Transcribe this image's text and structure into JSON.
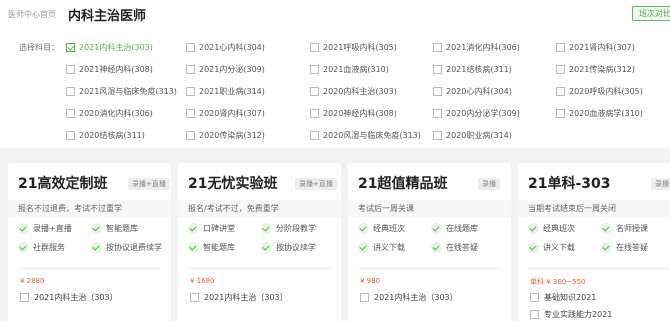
{
  "header": {
    "breadcrumb": "医师中心首页",
    "title": "内科主治医师",
    "compare_label": "班次对比"
  },
  "filter": {
    "label": "选择科目：",
    "options": [
      {
        "label": "2021内科主治(303)",
        "checked": true
      },
      {
        "label": "2021心内科(304)",
        "checked": false
      },
      {
        "label": "2021呼吸内科(305)",
        "checked": false
      },
      {
        "label": "2021消化内科(306)",
        "checked": false
      },
      {
        "label": "2021肾内科(307)",
        "checked": false
      },
      {
        "label": "2021神经内科(308)",
        "checked": false
      },
      {
        "label": "2021内分泌(309)",
        "checked": false
      },
      {
        "label": "2021血液病(310)",
        "checked": false
      },
      {
        "label": "2021结核病(311)",
        "checked": false
      },
      {
        "label": "2021传染病(312)",
        "checked": false
      },
      {
        "label": "2021风湿与临床免疫(313)",
        "checked": false
      },
      {
        "label": "2021职业病(314)",
        "checked": false
      },
      {
        "label": "2020内科主治(303)",
        "checked": false
      },
      {
        "label": "2020心内科(304)",
        "checked": false
      },
      {
        "label": "2020呼吸内科(305)",
        "checked": false
      },
      {
        "label": "2020消化内科(306)",
        "checked": false
      },
      {
        "label": "2020肾内科(307)",
        "checked": false
      },
      {
        "label": "2020神经内科(308)",
        "checked": false
      },
      {
        "label": "2020内分泌学(309)",
        "checked": false
      },
      {
        "label": "2020血液病学(310)",
        "checked": false
      },
      {
        "label": "2020结核病(311)",
        "checked": false
      },
      {
        "label": "2020传染病(312)",
        "checked": false
      },
      {
        "label": "2020风湿与临床免疫(313)",
        "checked": false
      },
      {
        "label": "2020职业病(314)",
        "checked": false
      }
    ]
  },
  "cards": [
    {
      "title": "21高效定制班",
      "tag": "录播+直播",
      "desc": "报名不过退费，考试不过重学",
      "features": [
        "录播+直播",
        "智能题库",
        "社群服务",
        "按协议退费续学"
      ],
      "price": "¥ 2880",
      "courses": [
        "2021内科主治（303）"
      ]
    },
    {
      "title": "21无忧实验班",
      "tag": "录播+直播",
      "desc": "报名/考试不过，免费重学",
      "features": [
        "口碑讲堂",
        "分阶段教学",
        "智能题库",
        "按协议续学"
      ],
      "price": "¥ 1680",
      "courses": [
        "2021内科主治（303）"
      ]
    },
    {
      "title": "21超值精品班",
      "tag": "录播",
      "desc": "考试后一周关课",
      "features": [
        "经典班次",
        "在线题库",
        "讲义下载",
        "在线答疑"
      ],
      "price": "¥ 980",
      "courses": [
        "2021内科主治（303）"
      ]
    },
    {
      "title": "21单科-303",
      "tag": "录播",
      "desc": "当期考试结束后一周关闭",
      "features": [
        "经典班次",
        "名师授课",
        "讲义下载",
        "在线答疑"
      ],
      "price": "单科 ¥ 300~550",
      "courses": [
        "基础知识2021",
        "专业实践能力2021"
      ]
    }
  ]
}
